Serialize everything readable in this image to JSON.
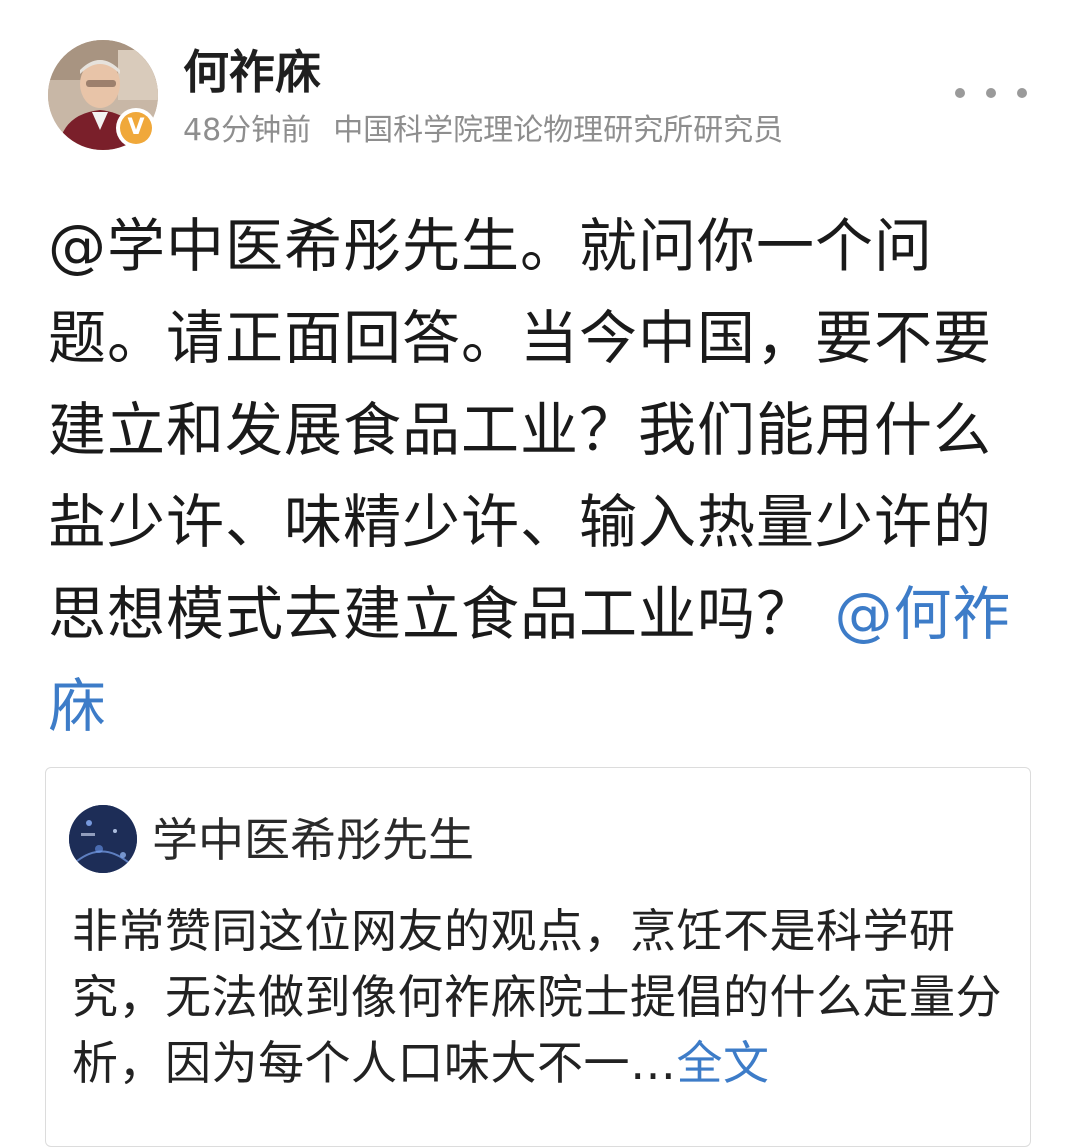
{
  "header": {
    "username": "何祚庥",
    "timestamp": "48分钟前",
    "user_title": "中国科学院理论物理研究所研究员",
    "verified_badge": "V"
  },
  "post": {
    "text": "@学中医希彤先生。就问你一个问题。请正面回答。当今中国，要不要建立和发展食品工业？我们能用什么盐少许、味精少许、输入热量少许的思想模式去建立食品工业吗？",
    "mention": "@何祚庥"
  },
  "quoted": {
    "username": "学中医希彤先生",
    "text": "非常赞同这位网友的观点，烹饪不是科学研究，无法做到像何祚庥院士提倡的什么定量分析，因为每个人口味大不一…",
    "fulltext_label": "全文"
  },
  "colors": {
    "link": "#3d7cc8",
    "meta_gray": "#8e8e8e",
    "verified": "#f0a83a"
  },
  "icons": {
    "more": "more-dots-icon",
    "verified": "verified-badge-icon"
  }
}
